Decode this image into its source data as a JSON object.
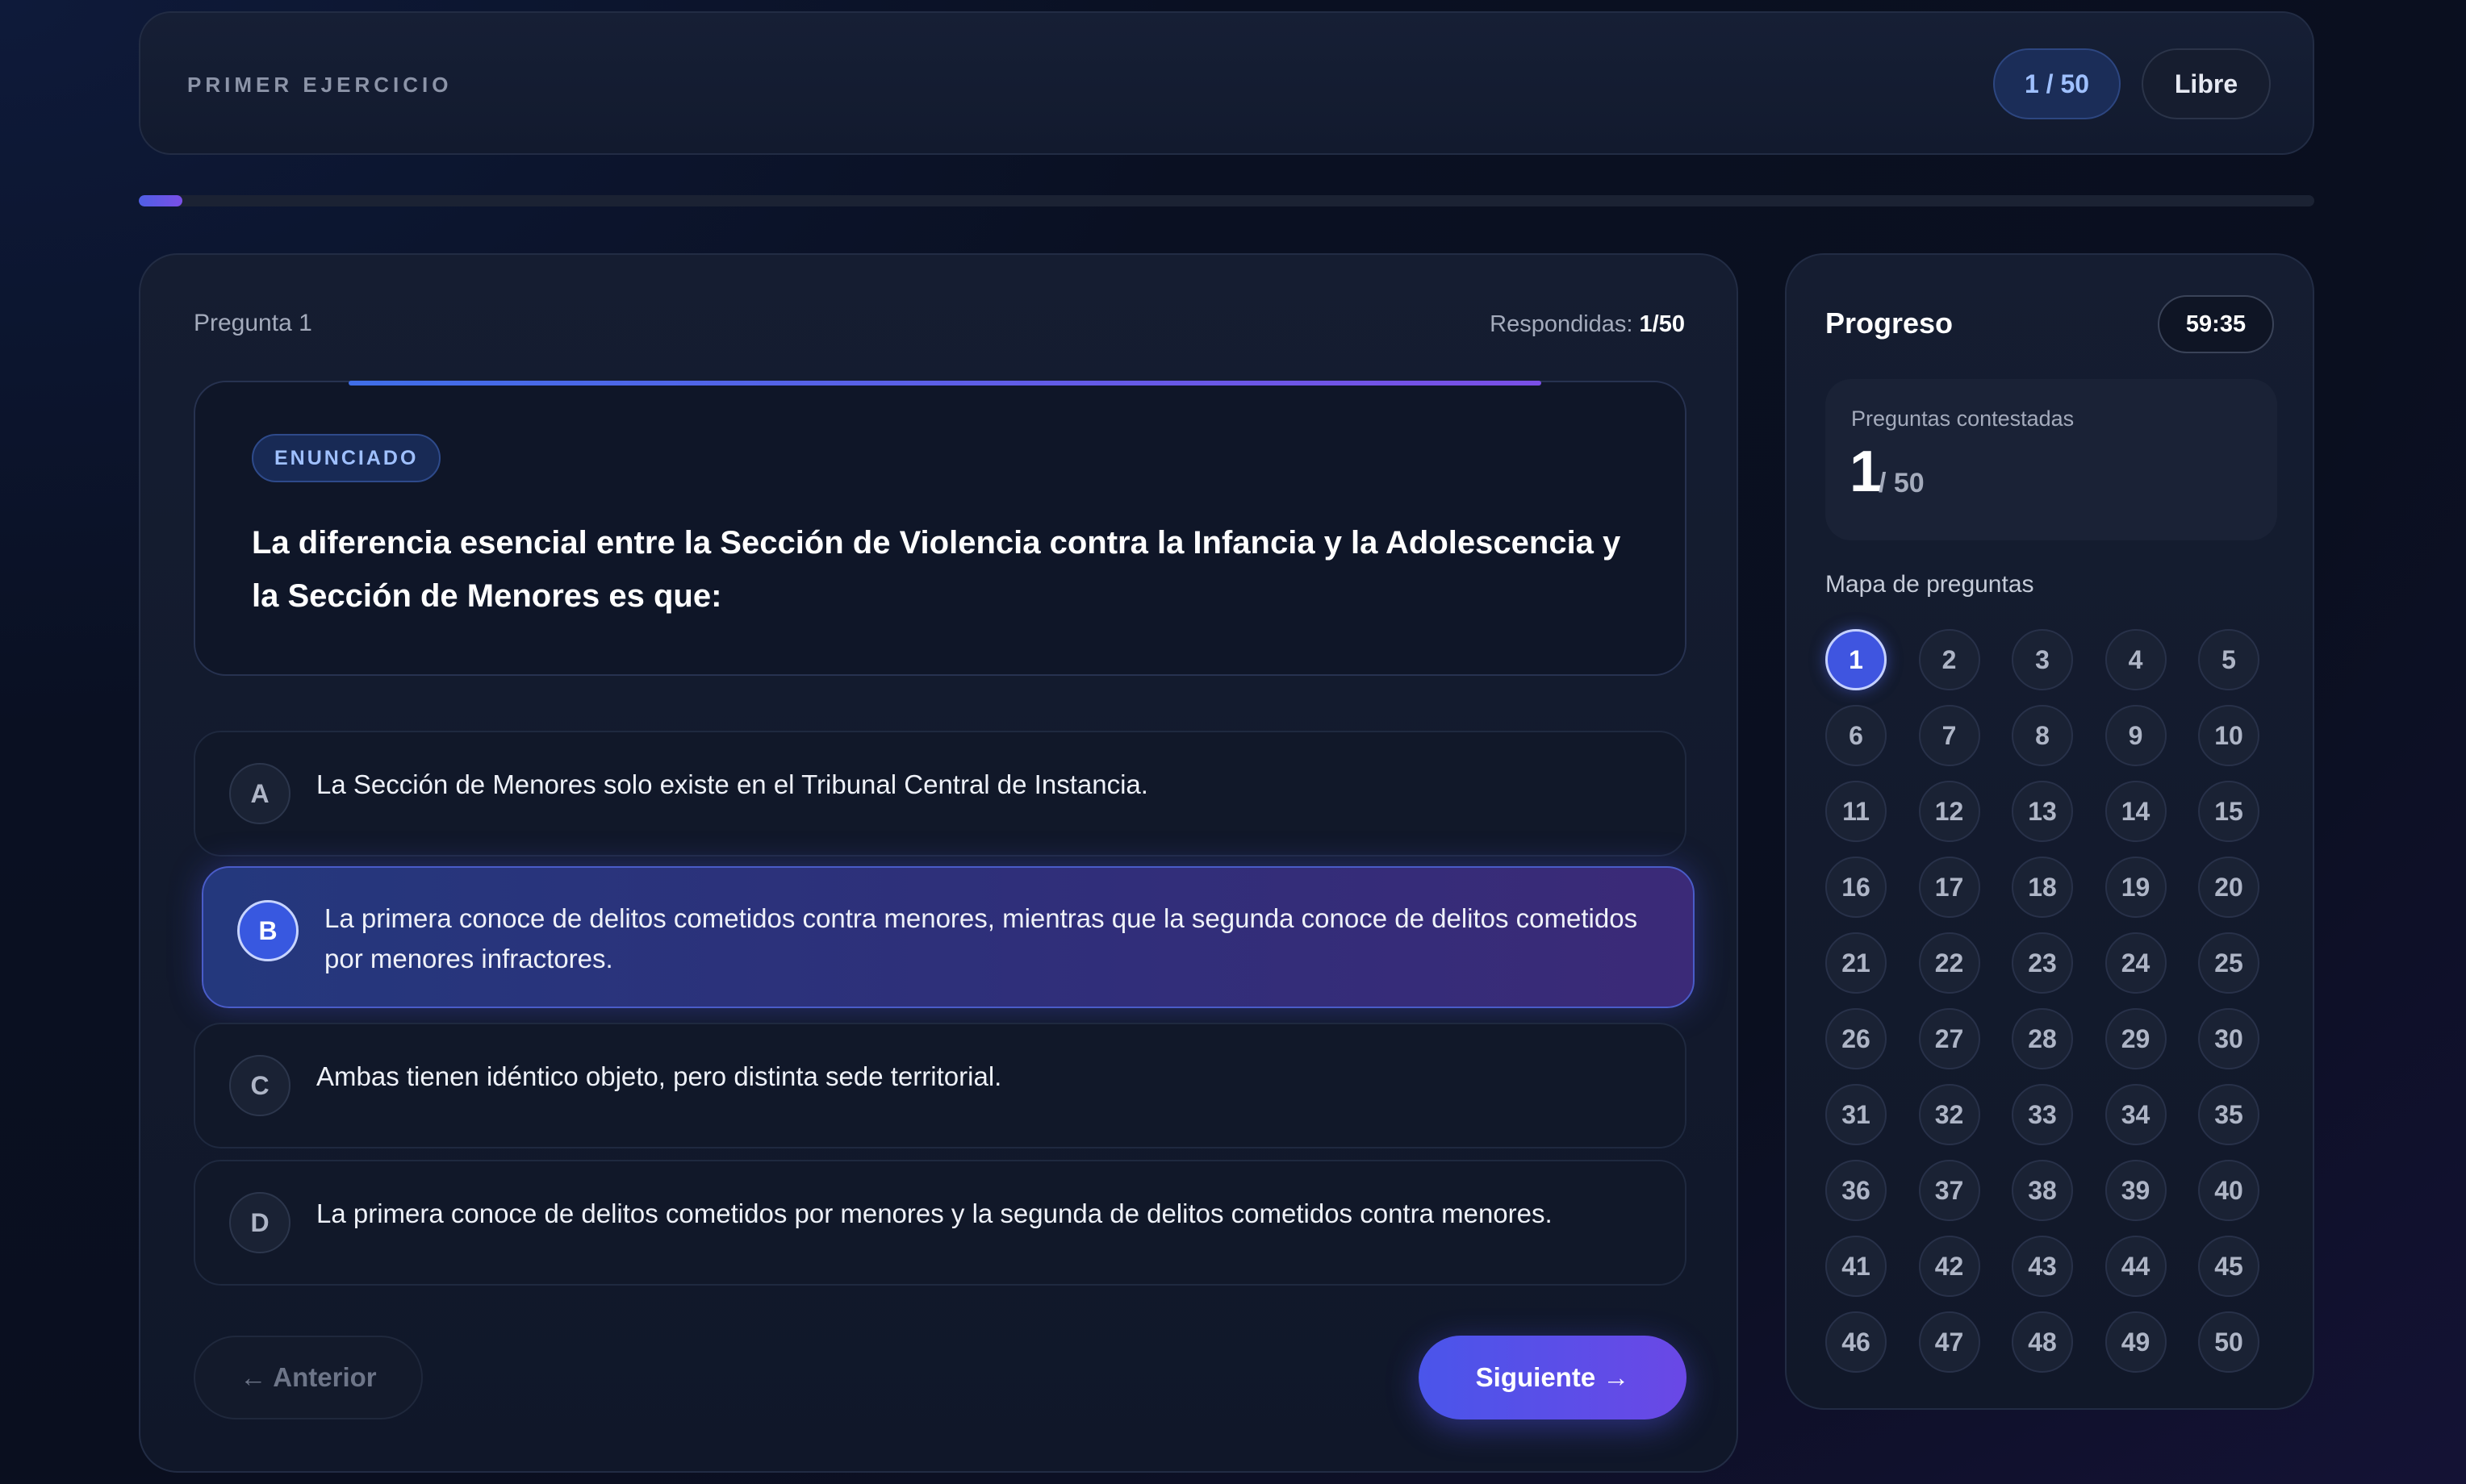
{
  "header": {
    "title": "PRIMER EJERCICIO",
    "count": "1 / 50",
    "mode": "Libre"
  },
  "progress": {
    "fraction": 0.02
  },
  "question": {
    "label": "Pregunta 1",
    "answered_label": "Respondidas: ",
    "answered_value": "1/50",
    "badge": "ENUNCIADO",
    "statement": "La diferencia esencial entre la Sección de Violencia contra la Infancia y la Adolescencia y la Sección de Menores es que:"
  },
  "options": [
    {
      "letter": "A",
      "text": "La Sección de Menores solo existe en el Tribunal Central de Instancia.",
      "selected": false
    },
    {
      "letter": "B",
      "text": "La primera conoce de delitos cometidos contra menores, mientras que la segunda conoce de delitos cometidos por menores infractores.",
      "selected": true
    },
    {
      "letter": "C",
      "text": "Ambas tienen idéntico objeto, pero distinta sede territorial.",
      "selected": false
    },
    {
      "letter": "D",
      "text": "La primera conoce de delitos cometidos por menores y la segunda de delitos cometidos contra menores.",
      "selected": false
    }
  ],
  "nav": {
    "prev": "← Anterior",
    "next": "Siguiente →"
  },
  "sidebar": {
    "title": "Progreso",
    "timer": "59:35",
    "answered_label": "Preguntas contestadas",
    "answered_value": "1",
    "answered_total": "/ 50",
    "map_label": "Mapa de preguntas",
    "current": 1,
    "numbers": [
      "1",
      "2",
      "3",
      "4",
      "5",
      "6",
      "7",
      "8",
      "9",
      "10",
      "11",
      "12",
      "13",
      "14",
      "15",
      "16",
      "17",
      "18",
      "19",
      "20",
      "21",
      "22",
      "23",
      "24",
      "25",
      "26",
      "27",
      "28",
      "29",
      "30",
      "31",
      "32",
      "33",
      "34",
      "35",
      "36",
      "37",
      "38",
      "39",
      "40",
      "41",
      "42",
      "43",
      "44",
      "45",
      "46",
      "47",
      "48",
      "49",
      "50"
    ]
  },
  "colors": {
    "accent": "#4a55ea",
    "accent_purple": "#6a48e6",
    "badge_text": "#9fc0ff"
  }
}
